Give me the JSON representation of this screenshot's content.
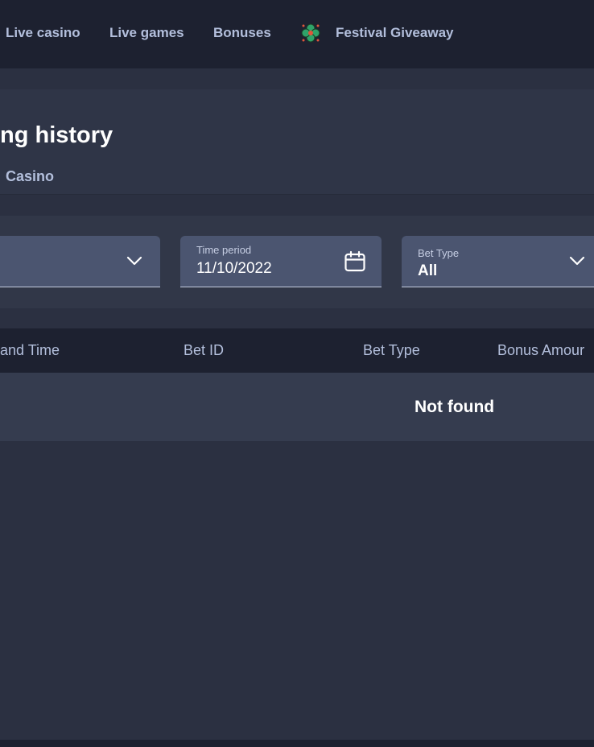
{
  "topnav": {
    "items": [
      {
        "label": "Live casino"
      },
      {
        "label": "Live games"
      },
      {
        "label": "Bonuses"
      },
      {
        "label": "Festival Giveaway",
        "icon": "clover-icon"
      }
    ]
  },
  "header": {
    "title": "ng history",
    "sub_tab": "Casino"
  },
  "filters": {
    "time_period": {
      "label": "Time period",
      "value": "11/10/2022",
      "icon": "calendar-icon"
    },
    "bet_type": {
      "label": "Bet Type",
      "value": "All",
      "icon": "chevron-down-icon"
    },
    "first": {
      "icon": "chevron-down-icon"
    }
  },
  "table": {
    "columns": [
      "and Time",
      "Bet ID",
      "Bet Type",
      "Bonus Amour"
    ],
    "empty_text": "Not found"
  },
  "colors": {
    "background": "#2b3041",
    "nav": "#1d2130",
    "field": "#4b5570",
    "muted_text": "#b3bfdc"
  }
}
